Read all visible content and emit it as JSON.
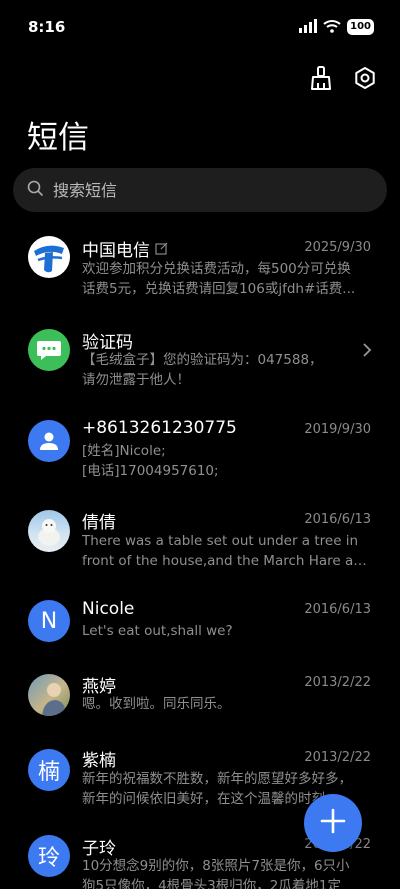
{
  "status": {
    "time": "8:16",
    "battery": "100"
  },
  "header": {
    "title": "短信"
  },
  "search": {
    "placeholder": "搜索短信"
  },
  "messages": [
    {
      "name": "中国电信",
      "date": "2025/9/30",
      "line1": "欢迎参加积分兑换话费活动，每500分可兑换",
      "line2": "话费5元，兑换话费请回复106或jfdh#话费..."
    },
    {
      "name": "验证码",
      "date": "",
      "line1": "【毛绒盒子】您的验证码为：047588，",
      "line2": "请勿泄露于他人！"
    },
    {
      "name": "+8613261230775",
      "date": "2019/9/30",
      "line1": "[姓名]Nicole;",
      "line2": "[电话]17004957610;"
    },
    {
      "name": "倩倩",
      "date": "2016/6/13",
      "line1": "There was a table set out under a tree in",
      "line2": "front of the house,and the March Hare an..."
    },
    {
      "name": "Nicole",
      "initial": "N",
      "date": "2016/6/13",
      "line1": "Let's eat out,shall we?",
      "line2": ""
    },
    {
      "name": "燕婷",
      "date": "2013/2/22",
      "line1": "嗯。收到啦。同乐同乐。",
      "line2": ""
    },
    {
      "name": "紫楠",
      "initial": "楠",
      "date": "2013/2/22",
      "line1": "新年的祝福数不胜数，新年的愿望好多好多，",
      "line2": "新年的问候依旧美好，在这个温馨的时刻，..."
    },
    {
      "name": "子玲",
      "initial": "玲",
      "date": "2013/2/22",
      "line1": "10分想念9别的你，8张照片7张是你，6只小",
      "line2": "狗5只像你，4根骨头3根归你，2瓜着地1定"
    }
  ],
  "colors": {
    "accent": "#3d79f0",
    "telecom": "#1d6fd3",
    "code_green": "#3cbe59"
  }
}
